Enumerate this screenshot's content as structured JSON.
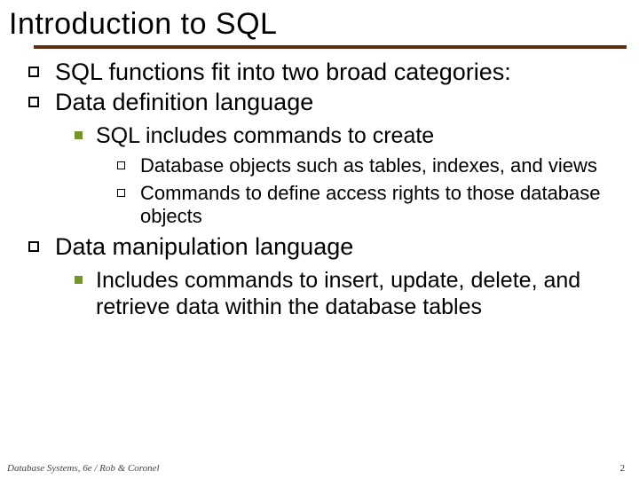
{
  "title": "Introduction to SQL",
  "bullets": {
    "b1": "SQL functions fit into two broad categories:",
    "b2": "Data definition language",
    "b2_1": "SQL includes commands to create",
    "b2_1_1": "Database objects such as tables, indexes, and views",
    "b2_1_2": "Commands to define access rights to those database objects",
    "b3": "Data manipulation language",
    "b3_1": "Includes commands to insert, update, delete, and retrieve data within the database tables"
  },
  "footer": "Database Systems, 6e / Rob & Coronel",
  "page_number": "2",
  "colors": {
    "underline": "#5c2d10",
    "square_fill": "#74932b"
  }
}
